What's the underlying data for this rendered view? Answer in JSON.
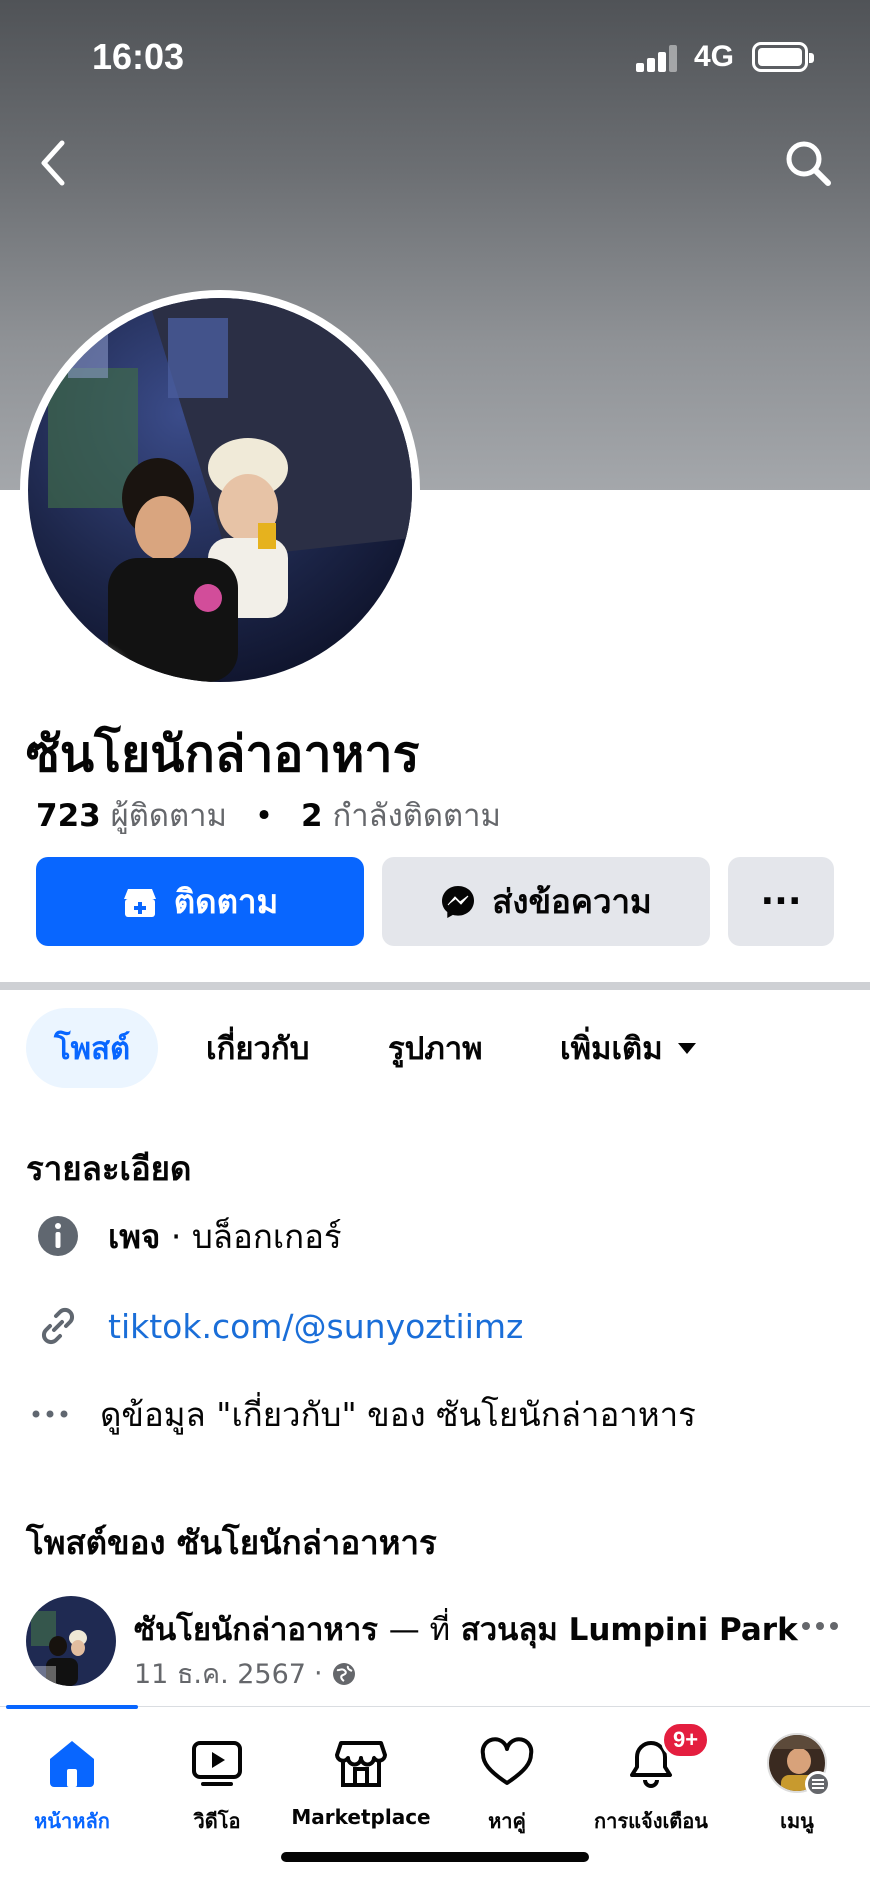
{
  "status_bar": {
    "time": "16:03",
    "network": "4G"
  },
  "profile": {
    "name": "ซันโยนักล่าอาหาร",
    "followers_count": "723",
    "followers_label": "ผู้ติดตาม",
    "following_count": "2",
    "following_label": "กำลังติดตาม"
  },
  "actions": {
    "follow_label": "ติดตาม",
    "message_label": "ส่งข้อความ",
    "more_label": "···"
  },
  "tabs": [
    {
      "label": "โพสต์",
      "active": true
    },
    {
      "label": "เกี่ยวกับ"
    },
    {
      "label": "รูปภาพ"
    },
    {
      "label": "เพิ่มเติม"
    }
  ],
  "details": {
    "title": "รายละเอียด",
    "page_type_bold": "เพจ",
    "page_category": " · บล็อกเกอร์",
    "link": "tiktok.com/@sunyoztiimz",
    "about_link": "ดูข้อมูล \"เกี่ยวกับ\" ของ ซันโยนักล่าอาหาร"
  },
  "posts": {
    "title": "โพสต์ของ ซันโยนักล่าอาหาร",
    "first_post": {
      "author": "ซันโยนักล่าอาหาร",
      "location_sep": "— ที่",
      "location": "สวนลุม Lumpini Park",
      "date": "11 ธ.ค. 2567",
      "meta_sep": "·"
    }
  },
  "bottom_nav": {
    "home": "หน้าหลัก",
    "video": "วิดีโอ",
    "marketplace": "Marketplace",
    "dating": "หาคู่",
    "notifications": "การแจ้งเตือน",
    "notifications_badge": "9+",
    "menu": "เมนู"
  },
  "colors": {
    "brand_blue": "#0866ff",
    "button_gray": "#e4e6eb",
    "badge_red": "#e41e3f",
    "link_blue": "#1a6ed8"
  }
}
